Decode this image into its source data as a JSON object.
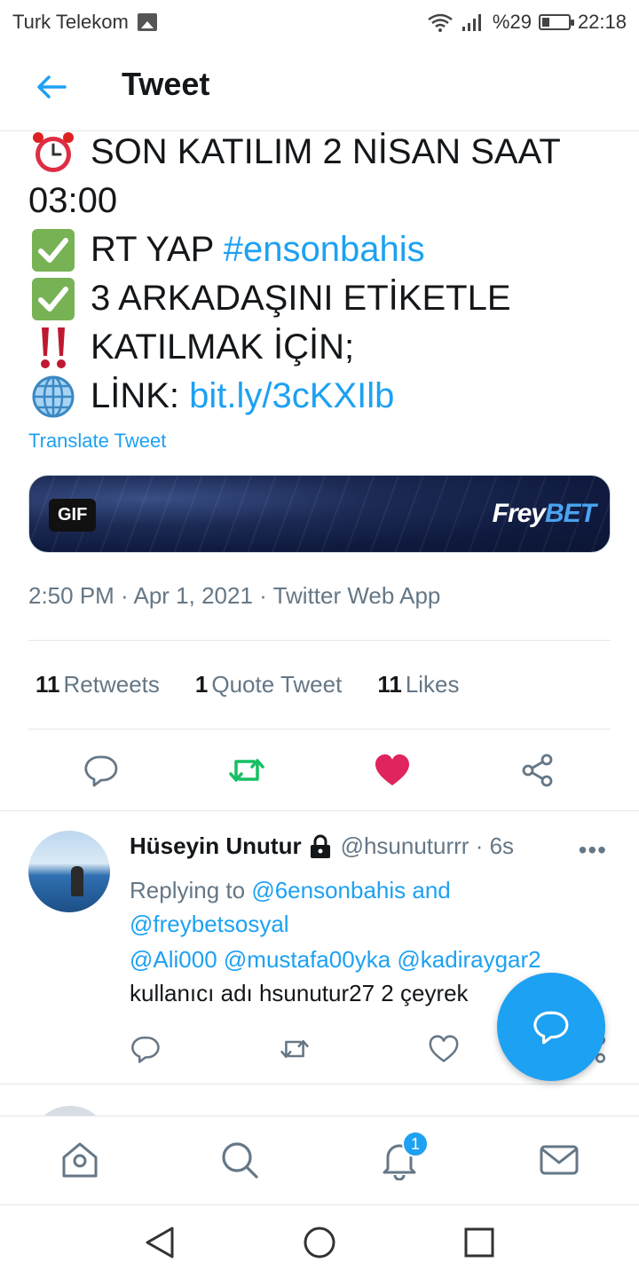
{
  "status_bar": {
    "carrier": "Turk Telekom",
    "battery": "%29",
    "battery_level": 0.29,
    "time": "22:18",
    "icons": [
      "image-icon",
      "wifi-icon",
      "signal-icon",
      "battery-icon"
    ]
  },
  "header": {
    "title": "Tweet",
    "back_icon": "back-arrow-icon"
  },
  "tweet": {
    "lines": [
      {
        "emoji": "alarm-clock-icon",
        "text": "SON KATILIM 2 NİSAN SAAT"
      },
      {
        "text": "03:00"
      },
      {
        "emoji": "check-mark-icon",
        "text": "RT YAP ",
        "link": "#ensonbahis"
      },
      {
        "emoji": "check-mark-icon",
        "text": "3 ARKADAŞINI ETİKETLE"
      },
      {
        "emoji": "double-exclamation-icon",
        "text": "KATILMAK İÇİN;"
      },
      {
        "emoji": "globe-icon",
        "text": "LİNK: ",
        "link": "bit.ly/3cKXIlb"
      }
    ],
    "translate": "Translate Tweet",
    "media": {
      "badge": "GIF",
      "brand_part1": "Frey",
      "brand_part2": "BET"
    },
    "timestamp": "2:50 PM · Apr 1, 2021 · Twitter Web App",
    "stats": [
      {
        "count": "11",
        "label": "Retweets"
      },
      {
        "count": "1",
        "label": "Quote Tweet"
      },
      {
        "count": "11",
        "label": "Likes"
      }
    ],
    "actions": [
      "reply-icon",
      "retweet-icon",
      "like-icon",
      "share-icon"
    ],
    "colors": {
      "retweet": "#17bf63",
      "like": "#e0245e",
      "link": "#1da1f2"
    }
  },
  "reply": {
    "name": "Hüseyin Unutur",
    "handle": "@hsunuturrr · 6s",
    "more": "•••",
    "replying_prefix": "Replying to ",
    "replying_to": "@6ensonbahis and @freybetsosyal",
    "mentions": "@Ali000 @mustafa00yka @kadiraygar2",
    "text": "kullanıcı adı hsunutur27 2 çeyrek"
  },
  "bottom_nav": {
    "items": [
      "home-icon",
      "search-icon",
      "notifications-icon",
      "messages-icon"
    ],
    "notification_badge": "1"
  },
  "system_nav": [
    "back-triangle-icon",
    "home-circle-icon",
    "recents-square-icon"
  ]
}
